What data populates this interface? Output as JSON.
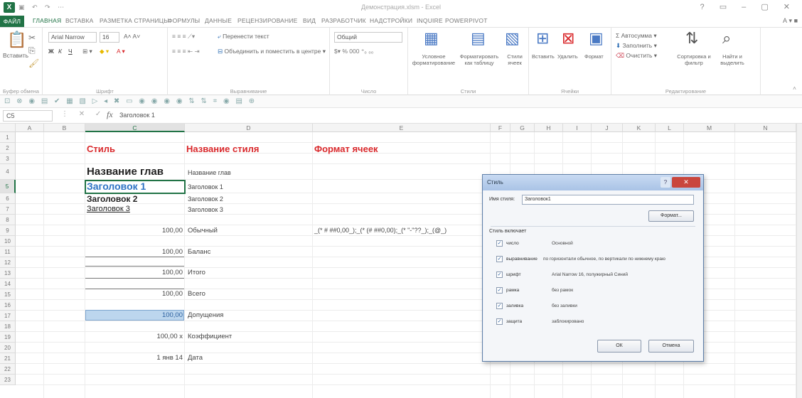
{
  "window": {
    "title": "Демонстрация.xlsm - Excel",
    "qa_icons": "▣ ↶ ↷ ⋯"
  },
  "tabs": [
    "ФАЙЛ",
    "ГЛАВНАЯ",
    "ВСТАВКА",
    "РАЗМЕТКА СТРАНИЦЫ",
    "ФОРМУЛЫ",
    "ДАННЫЕ",
    "РЕЦЕНЗИРОВАНИЕ",
    "ВИД",
    "РАЗРАБОТЧИК",
    "НАДСТРОЙКИ",
    "INQUIRE",
    "POWERPIVOT"
  ],
  "user": "А",
  "ribbon": {
    "clipboard": {
      "paste": "Вставить",
      "label": "Буфер обмена"
    },
    "font": {
      "name": "Arial Narrow",
      "size": "16",
      "label": "Шрифт"
    },
    "alignment": {
      "wrap": "Перенести текст",
      "merge": "Объединить и поместить в центре",
      "label": "Выравнивание"
    },
    "number": {
      "format": "Общий",
      "label": "Число"
    },
    "styles": {
      "conditional": "Условное форматирование",
      "table": "Форматировать как таблицу",
      "cell": "Стили ячеек",
      "label": "Стили"
    },
    "cells": {
      "insert": "Вставить",
      "delete": "Удалить",
      "format": "Формат",
      "label": "Ячейки"
    },
    "editing": {
      "autosum": "Автосумма",
      "fill": "Заполнить",
      "clear": "Очистить",
      "sort": "Сортировка и фильтр",
      "find": "Найти и выделить",
      "label": "Редактирование"
    }
  },
  "qrow_icons": "⊡ ⊗ ◉ ▤ ✔ ▦ ▧ ▷ ◂ ✖ ▭ ◉ ◉ ◉ ◉ ⇅ ⇅ ⌗ ◉ ▤ ⊕",
  "formula_bar": {
    "name_box": "C5",
    "fx": "fx",
    "value": "Заголовок 1"
  },
  "columns": [
    "A",
    "B",
    "C",
    "D",
    "E",
    "F",
    "G",
    "H",
    "I",
    "J",
    "K",
    "L",
    "M",
    "N"
  ],
  "rows": [
    "1",
    "2",
    "3",
    "4",
    "5",
    "6",
    "7",
    "8",
    "9",
    "10",
    "11",
    "12",
    "13",
    "14",
    "15",
    "16",
    "17",
    "18",
    "19",
    "20",
    "21",
    "22",
    "23"
  ],
  "cells": {
    "c2": "Стиль",
    "d2": "Название стиля",
    "e2": "Формат ячеек",
    "c4": "Название глав",
    "d4": "Название глав",
    "c5": "Заголовок 1",
    "d5": "Заголовок 1",
    "c6": "Заголовок 2",
    "d6": "Заголовок 2",
    "c7": "Заголовок 3",
    "d7": "Заголовок 3",
    "c9": "100,00",
    "d9": "Обычный",
    "e9": "_(* # ##0,00_);_(* (# ##0,00);_(* \"-\"??_);_(@_)",
    "c11": "100,00",
    "d11": "Баланс",
    "c13": "100,00",
    "d13": "Итого",
    "c15": "100,00",
    "d15": "Всего",
    "c17": "100,00",
    "d17": "Допущения",
    "c19": "100,00 x",
    "d19": "Коэффициент",
    "c21": "1 янв 14",
    "d21": "Дата"
  },
  "dialog": {
    "title": "Стиль",
    "close": "✕",
    "help": "?",
    "name_label": "Имя стиля:",
    "name_value": "Заголовок1",
    "format_button": "Формат...",
    "includes_label": "Стиль включает",
    "items": [
      {
        "label": "число",
        "value": "Основной"
      },
      {
        "label": "выравнивание",
        "value": "по горизонтали обычное, по вертикали по нижнему краю"
      },
      {
        "label": "шрифт",
        "value": "Arial Narrow 16, полужирный Синий"
      },
      {
        "label": "рамка",
        "value": "без рамок"
      },
      {
        "label": "заливка",
        "value": "без заливки"
      },
      {
        "label": "защита",
        "value": "заблокировано"
      }
    ],
    "ok": "ОК",
    "cancel": "Отмена"
  }
}
